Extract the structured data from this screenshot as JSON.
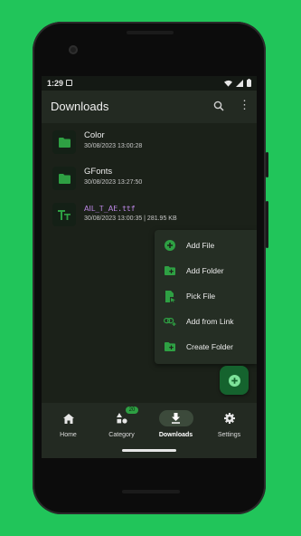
{
  "status_bar": {
    "time": "1:29"
  },
  "app_bar": {
    "title": "Downloads"
  },
  "files": [
    {
      "name": "Color",
      "meta": "30/08/2023 13:00:28",
      "icon": "folder-icon"
    },
    {
      "name": "GFonts",
      "meta": "30/08/2023 13:27:50",
      "icon": "folder-icon"
    },
    {
      "name": "ꓮꓲꓡ_Ꭲ_ꓮꓰ.ttf",
      "meta": "30/08/2023 13:00:35 | 281.95 KB",
      "icon": "font-icon"
    }
  ],
  "menu": {
    "items": [
      {
        "label": "Add File",
        "icon": "add-circle-icon"
      },
      {
        "label": "Add Folder",
        "icon": "add-folder-icon"
      },
      {
        "label": "Pick File",
        "icon": "pick-file-icon"
      },
      {
        "label": "Add from Link",
        "icon": "add-link-icon"
      },
      {
        "label": "Create Folder",
        "icon": "create-folder-icon"
      }
    ]
  },
  "bottom_nav": {
    "items": [
      {
        "label": "Home",
        "icon": "home-icon"
      },
      {
        "label": "Category",
        "icon": "category-icon",
        "badge": "20"
      },
      {
        "label": "Downloads",
        "icon": "download-icon",
        "active": true
      },
      {
        "label": "Settings",
        "icon": "gear-icon"
      }
    ]
  },
  "colors": {
    "background": "#21c55a",
    "screen": "#1b2119",
    "surface": "#232a22",
    "accent": "#2ea043",
    "fab": "#15632e"
  }
}
